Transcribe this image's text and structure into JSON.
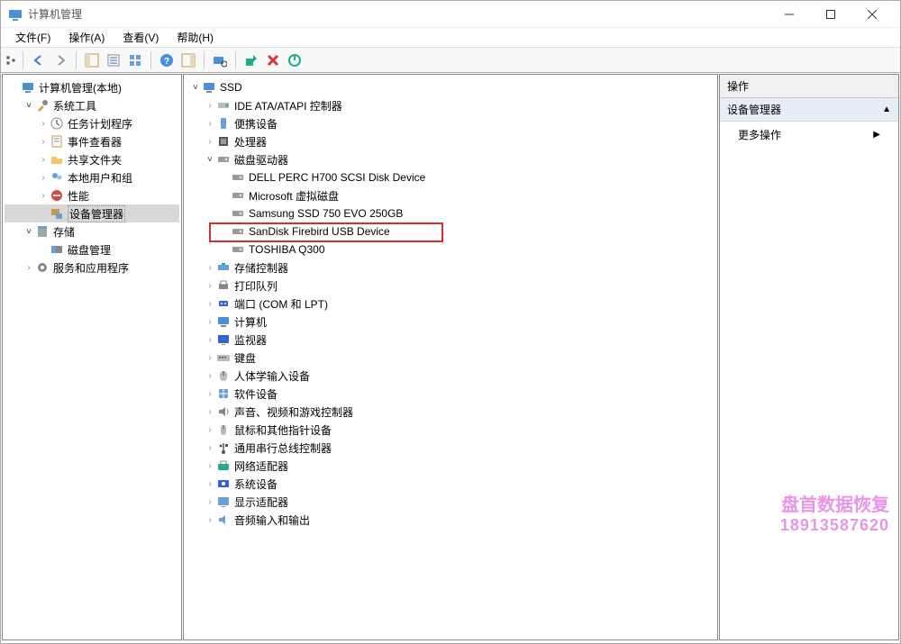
{
  "window": {
    "title": "计算机管理",
    "min": "–",
    "max": "☐",
    "close": "✕"
  },
  "menu": {
    "file": "文件(F)",
    "action": "操作(A)",
    "view": "查看(V)",
    "help": "帮助(H)"
  },
  "left_tree": [
    {
      "indent": 0,
      "exp": "",
      "icon": "computer",
      "label": "计算机管理(本地)"
    },
    {
      "indent": 1,
      "exp": "▾",
      "icon": "tools",
      "label": "系统工具"
    },
    {
      "indent": 2,
      "exp": "▸",
      "icon": "sched",
      "label": "任务计划程序"
    },
    {
      "indent": 2,
      "exp": "▸",
      "icon": "event",
      "label": "事件查看器"
    },
    {
      "indent": 2,
      "exp": "▸",
      "icon": "share",
      "label": "共享文件夹"
    },
    {
      "indent": 2,
      "exp": "▸",
      "icon": "users",
      "label": "本地用户和组"
    },
    {
      "indent": 2,
      "exp": "▸",
      "icon": "perf",
      "label": "性能"
    },
    {
      "indent": 2,
      "exp": "",
      "icon": "devmgr",
      "label": "设备管理器",
      "selected": true
    },
    {
      "indent": 1,
      "exp": "▾",
      "icon": "storage",
      "label": "存储"
    },
    {
      "indent": 2,
      "exp": "",
      "icon": "diskmgmt",
      "label": "磁盘管理"
    },
    {
      "indent": 1,
      "exp": "▸",
      "icon": "services",
      "label": "服务和应用程序"
    }
  ],
  "mid_tree": [
    {
      "indent": 0,
      "exp": "▾",
      "icon": "computer",
      "label": "SSD"
    },
    {
      "indent": 1,
      "exp": "▸",
      "icon": "ide",
      "label": "IDE ATA/ATAPI 控制器"
    },
    {
      "indent": 1,
      "exp": "▸",
      "icon": "portable",
      "label": "便携设备"
    },
    {
      "indent": 1,
      "exp": "▸",
      "icon": "cpu",
      "label": "处理器"
    },
    {
      "indent": 1,
      "exp": "▾",
      "icon": "disk",
      "label": "磁盘驱动器"
    },
    {
      "indent": 2,
      "exp": "",
      "icon": "disk",
      "label": "DELL PERC H700 SCSI Disk Device"
    },
    {
      "indent": 2,
      "exp": "",
      "icon": "disk",
      "label": "Microsoft 虚拟磁盘"
    },
    {
      "indent": 2,
      "exp": "",
      "icon": "disk",
      "label": "Samsung SSD 750 EVO 250GB"
    },
    {
      "indent": 2,
      "exp": "",
      "icon": "disk",
      "label": "SanDisk Firebird USB Device",
      "boxed": true
    },
    {
      "indent": 2,
      "exp": "",
      "icon": "disk",
      "label": "TOSHIBA Q300"
    },
    {
      "indent": 1,
      "exp": "▸",
      "icon": "storage-ctrl",
      "label": "存储控制器"
    },
    {
      "indent": 1,
      "exp": "▸",
      "icon": "printq",
      "label": "打印队列"
    },
    {
      "indent": 1,
      "exp": "▸",
      "icon": "ports",
      "label": "端口 (COM 和 LPT)"
    },
    {
      "indent": 1,
      "exp": "▸",
      "icon": "computer",
      "label": "计算机"
    },
    {
      "indent": 1,
      "exp": "▸",
      "icon": "monitor",
      "label": "监视器"
    },
    {
      "indent": 1,
      "exp": "▸",
      "icon": "keyboard",
      "label": "键盘"
    },
    {
      "indent": 1,
      "exp": "▸",
      "icon": "hid",
      "label": "人体学输入设备"
    },
    {
      "indent": 1,
      "exp": "▸",
      "icon": "software",
      "label": "软件设备"
    },
    {
      "indent": 1,
      "exp": "▸",
      "icon": "audio",
      "label": "声音、视频和游戏控制器"
    },
    {
      "indent": 1,
      "exp": "▸",
      "icon": "mouse",
      "label": "鼠标和其他指针设备"
    },
    {
      "indent": 1,
      "exp": "▸",
      "icon": "usb",
      "label": "通用串行总线控制器"
    },
    {
      "indent": 1,
      "exp": "▸",
      "icon": "network",
      "label": "网络适配器"
    },
    {
      "indent": 1,
      "exp": "▸",
      "icon": "system",
      "label": "系统设备"
    },
    {
      "indent": 1,
      "exp": "▸",
      "icon": "display",
      "label": "显示适配器"
    },
    {
      "indent": 1,
      "exp": "▸",
      "icon": "audio-io",
      "label": "音频输入和输出"
    }
  ],
  "right": {
    "header": "操作",
    "section": "设备管理器",
    "more": "更多操作"
  },
  "watermark": {
    "line1": "盘首数据恢复",
    "line2": "18913587620"
  },
  "icon_glyphs": {
    "computer": "🖥",
    "tools": "🛠",
    "sched": "⏱",
    "event": "📋",
    "share": "📁",
    "users": "👥",
    "perf": "⛔",
    "devmgr": "🖨",
    "storage": "🗄",
    "diskmgmt": "💽",
    "services": "⚙",
    "ide": "💾",
    "portable": "📱",
    "cpu": "▣",
    "disk": "💽",
    "storage-ctrl": "🔧",
    "printq": "🖨",
    "ports": "🔌",
    "monitor": "🖥",
    "keyboard": "⌨",
    "hid": "🖱",
    "software": "📦",
    "audio": "🔊",
    "mouse": "🖱",
    "usb": "ᵁ",
    "network": "🌐",
    "system": "🖥",
    "display": "🖥",
    "audio-io": "🎤"
  }
}
